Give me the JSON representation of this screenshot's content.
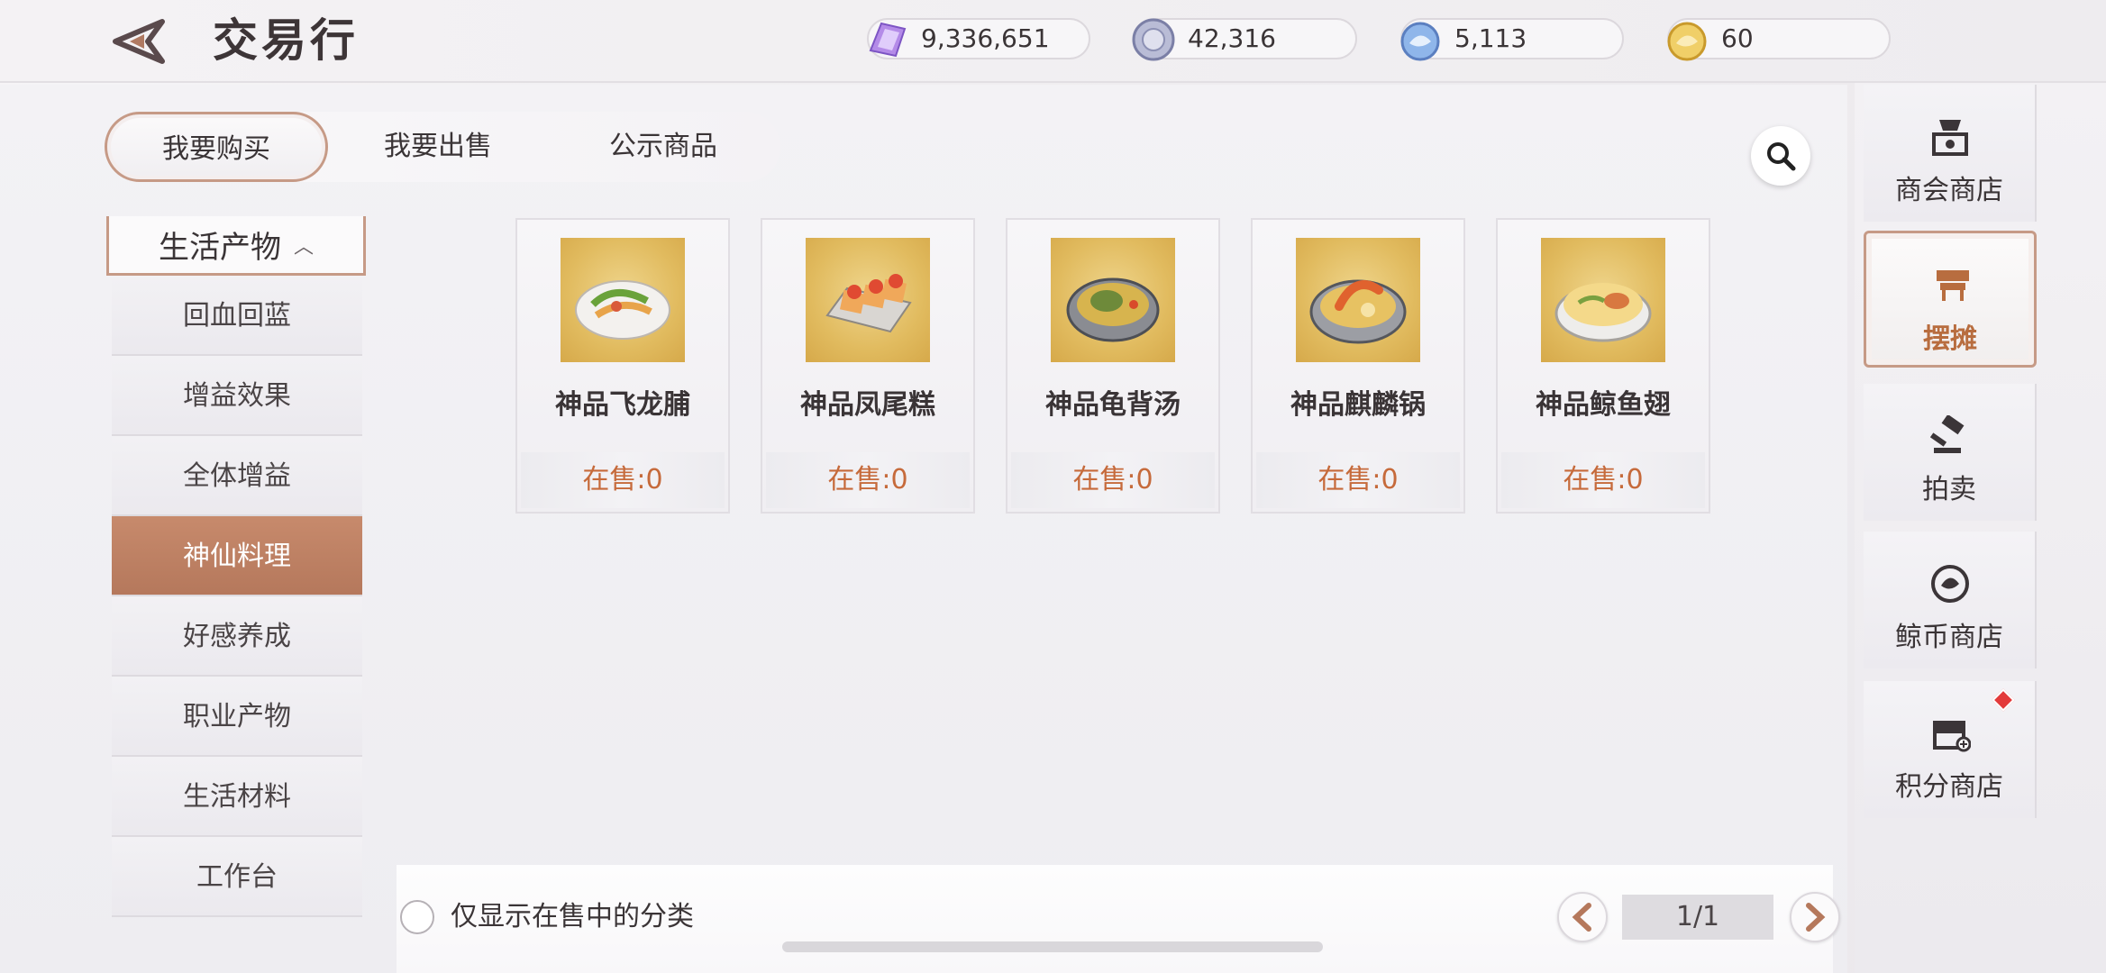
{
  "header": {
    "title": "交易行",
    "currencies": [
      {
        "icon": "purple-crystal-icon",
        "value": "9,336,651"
      },
      {
        "icon": "silver-coin-icon",
        "value": "42,316"
      },
      {
        "icon": "whale-coin-icon",
        "value": "5,113"
      },
      {
        "icon": "gold-whale-icon",
        "value": "60"
      }
    ]
  },
  "tabs": [
    {
      "label": "我要购买",
      "active": true
    },
    {
      "label": "我要出售",
      "active": false
    },
    {
      "label": "公示商品",
      "active": false
    }
  ],
  "category": {
    "header": "生活产物",
    "items": [
      "回血回蓝",
      "增益效果",
      "全体增益",
      "神仙料理",
      "好感养成",
      "职业产物",
      "生活材料",
      "工作台"
    ],
    "active_index": 3
  },
  "goods": [
    {
      "name": "神品飞龙脯",
      "stock": "在售:0"
    },
    {
      "name": "神品凤尾糕",
      "stock": "在售:0"
    },
    {
      "name": "神品龟背汤",
      "stock": "在售:0"
    },
    {
      "name": "神品麒麟锅",
      "stock": "在售:0"
    },
    {
      "name": "神品鲸鱼翅",
      "stock": "在售:0"
    }
  ],
  "filter": {
    "label": "仅显示在售中的分类",
    "checked": false
  },
  "pagination": {
    "text": "1/1"
  },
  "side_nav": [
    {
      "label": "商会商店",
      "icon": "merchant-shop-icon",
      "active": false
    },
    {
      "label": "摆摊",
      "icon": "stall-icon",
      "active": true
    },
    {
      "label": "拍卖",
      "icon": "auction-hammer-icon",
      "active": false
    },
    {
      "label": "鲸币商店",
      "icon": "whale-coin-shop-icon",
      "active": false
    },
    {
      "label": "积分商店",
      "icon": "points-shop-icon",
      "active": false,
      "badge": true
    }
  ],
  "colors": {
    "accent": "#c69a86",
    "active_category": "#c07f62",
    "stock_text": "#c66a3b",
    "badge": "#e33a3a"
  }
}
